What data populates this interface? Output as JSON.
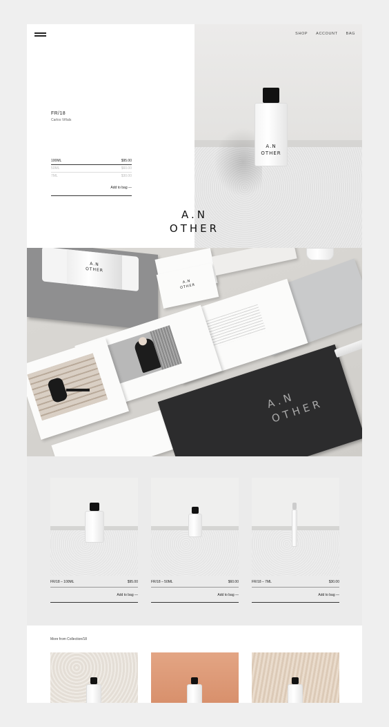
{
  "nav": {
    "items": [
      "SHOP",
      "ACCOUNT",
      "BAG"
    ]
  },
  "hero": {
    "product_title": "FR/18",
    "product_subtitle": "Carlos Viñals",
    "sizes": [
      {
        "label": "100ML",
        "price": "$95.00"
      },
      {
        "label": "50ML",
        "price": "$60.00"
      },
      {
        "label": "7ML",
        "price": "$30.00"
      }
    ],
    "add_to_bag": "Add to bag —",
    "logo_line1": "A.N",
    "logo_line2": "OTHER",
    "bottle_label1": "A.N",
    "bottle_label2": "OTHER"
  },
  "stationery": {
    "card_logo1": "A.N",
    "card_logo2": "OTHER",
    "dark_logo1": "A.N",
    "dark_logo2": "OTHER",
    "box_logo1": "A.N",
    "box_logo2": "OTHER"
  },
  "products": [
    {
      "name": "FR/18 – 100ML",
      "price": "$95.00",
      "add": "Add to bag —"
    },
    {
      "name": "FR/18 – 50ML",
      "price": "$60.00",
      "add": "Add to bag —"
    },
    {
      "name": "FR/18 – 7ML",
      "price": "$30.00",
      "add": "Add to bag —"
    }
  ],
  "more": {
    "title": "More from Collection/18"
  },
  "colors": {
    "accent_dark": "#2c2c2d",
    "peach": "#e0a07f",
    "wood": "#e7d8c8",
    "stone": "#ece8e2"
  }
}
